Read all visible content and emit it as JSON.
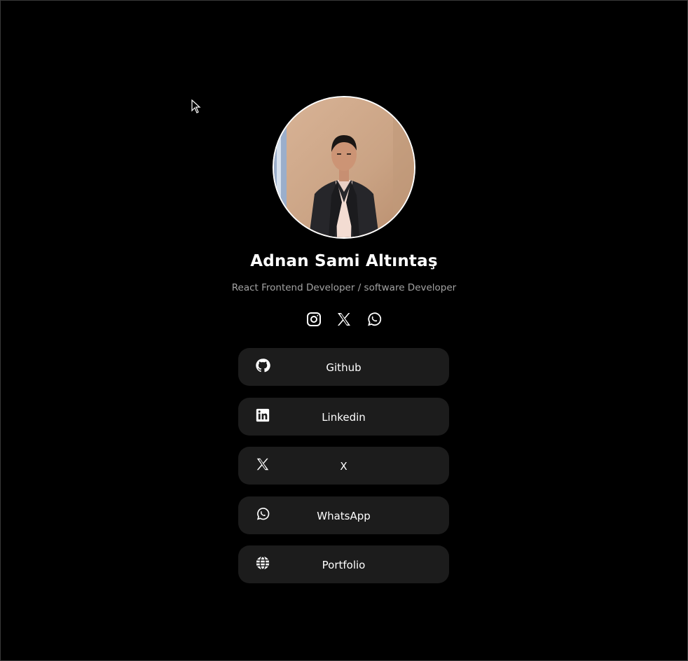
{
  "profile": {
    "name": "Adnan Sami Altıntaş",
    "subtitle": "React Frontend Developer / software Developer"
  },
  "social_icons": [
    "instagram-icon",
    "x-icon",
    "whatsapp-icon"
  ],
  "links": [
    {
      "label": "Github",
      "icon": "github-icon"
    },
    {
      "label": "Linkedin",
      "icon": "linkedin-icon"
    },
    {
      "label": "X",
      "icon": "x-icon"
    },
    {
      "label": "WhatsApp",
      "icon": "whatsapp-icon"
    },
    {
      "label": "Portfolio",
      "icon": "globe-icon"
    }
  ],
  "colors": {
    "background": "#000000",
    "button_bg": "#1c1c1c",
    "subtitle": "#a3a3a3",
    "text": "#ffffff"
  }
}
